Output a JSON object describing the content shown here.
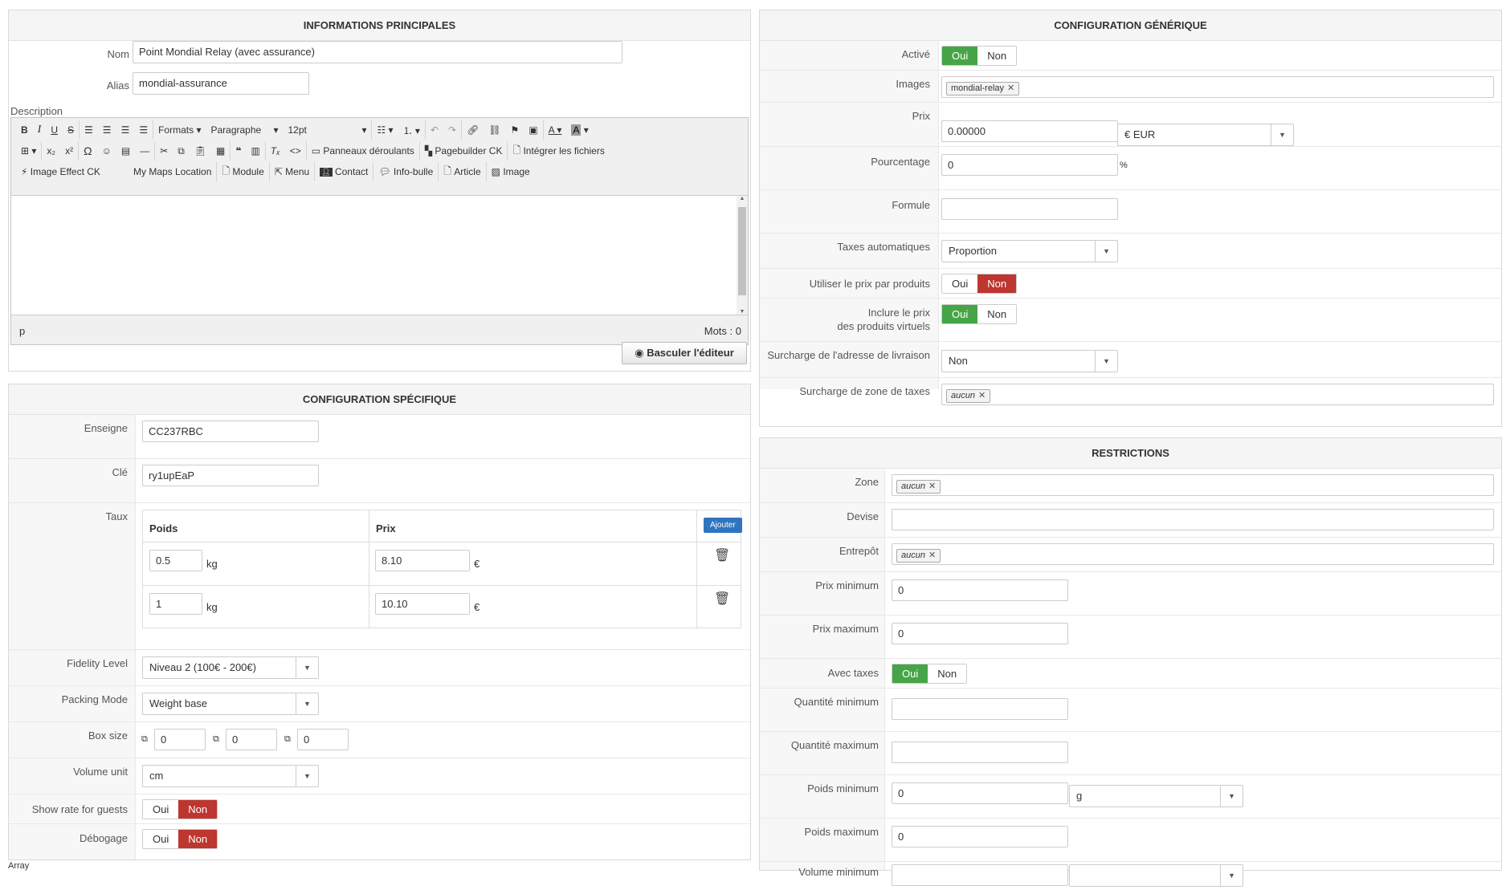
{
  "main_info": {
    "title": "INFORMATIONS PRINCIPALES",
    "nom_label": "Nom",
    "nom_value": "Point Mondial Relay (avec assurance)",
    "alias_label": "Alias",
    "alias_value": "mondial-assurance",
    "description_label": "Description",
    "toolbar1": {
      "formats": "Formats",
      "paragraph": "Paragraphe",
      "fontsize": "12pt"
    },
    "toolbar2": {
      "panels": "Panneaux déroulants",
      "pagebuilder": "Pagebuilder CK",
      "integrate": "Intégrer les fichiers"
    },
    "toolbar3": {
      "image_effect": "Image Effect CK",
      "maps": "My Maps Location",
      "module": "Module",
      "menu": "Menu",
      "contact": "Contact",
      "infobulle": "Info-bulle",
      "article": "Article",
      "image": "Image"
    },
    "statusbar_path": "p",
    "statusbar_words": "Mots : 0",
    "toggle_editor": "Basculer l'éditeur"
  },
  "specific": {
    "title": "CONFIGURATION SPÉCIFIQUE",
    "enseigne_label": "Enseigne",
    "enseigne_value": "CC237RBC",
    "cle_label": "Clé",
    "cle_value": "ry1upEaP",
    "taux_label": "Taux",
    "taux_head_poids": "Poids",
    "taux_head_prix": "Prix",
    "taux_add": "Ajouter",
    "rates": [
      {
        "poids": "0.5",
        "poids_unit": "kg",
        "prix": "8.10",
        "prix_unit": "€"
      },
      {
        "poids": "1",
        "poids_unit": "kg",
        "prix": "10.10",
        "prix_unit": "€"
      }
    ],
    "fidelity_label": "Fidelity Level",
    "fidelity_value": "Niveau 2 (100€ - 200€)",
    "packing_label": "Packing Mode",
    "packing_value": "Weight base",
    "box_label": "Box size",
    "box_values": [
      "0",
      "0",
      "0"
    ],
    "volume_label": "Volume unit",
    "volume_value": "cm",
    "show_rate_label": "Show rate for guests",
    "debug_label": "Débogage",
    "oui": "Oui",
    "non": "Non"
  },
  "footer_text": "Array",
  "generic": {
    "title": "CONFIGURATION GÉNÉRIQUE",
    "active_label": "Activé",
    "images_label": "Images",
    "images_tag": "mondial-relay",
    "prix_label": "Prix",
    "prix_value": "0.00000",
    "currency_value": "€ EUR",
    "pourcentage_label": "Pourcentage",
    "pourcentage_value": "0",
    "pourcentage_unit": "%",
    "formule_label": "Formule",
    "formule_value": "",
    "taxes_label": "Taxes automatiques",
    "taxes_value": "Proportion",
    "use_product_price_label": "Utiliser le prix par produits",
    "include_virtual_label_1": "Inclure le prix",
    "include_virtual_label_2": "des produits virtuels",
    "override_address_label": "Surcharge de l'adresse de livraison",
    "override_address_value": "Non",
    "override_zone_label": "Surcharge de zone de taxes",
    "override_zone_tag": "aucun",
    "oui": "Oui",
    "non": "Non"
  },
  "restrictions": {
    "title": "RESTRICTIONS",
    "zone_label": "Zone",
    "zone_tag": "aucun",
    "devise_label": "Devise",
    "entrepot_label": "Entrepôt",
    "entrepot_tag": "aucun",
    "prix_min_label": "Prix minimum",
    "prix_min_value": "0",
    "prix_max_label": "Prix maximum",
    "prix_max_value": "0",
    "avec_taxes_label": "Avec taxes",
    "qte_min_label": "Quantité minimum",
    "qte_max_label": "Quantité maximum",
    "poids_min_label": "Poids minimum",
    "poids_min_value": "0",
    "poids_unit_value": "g",
    "poids_max_label": "Poids maximum",
    "poids_max_value": "0",
    "volume_min_label": "Volume minimum",
    "oui": "Oui",
    "non": "Non"
  }
}
